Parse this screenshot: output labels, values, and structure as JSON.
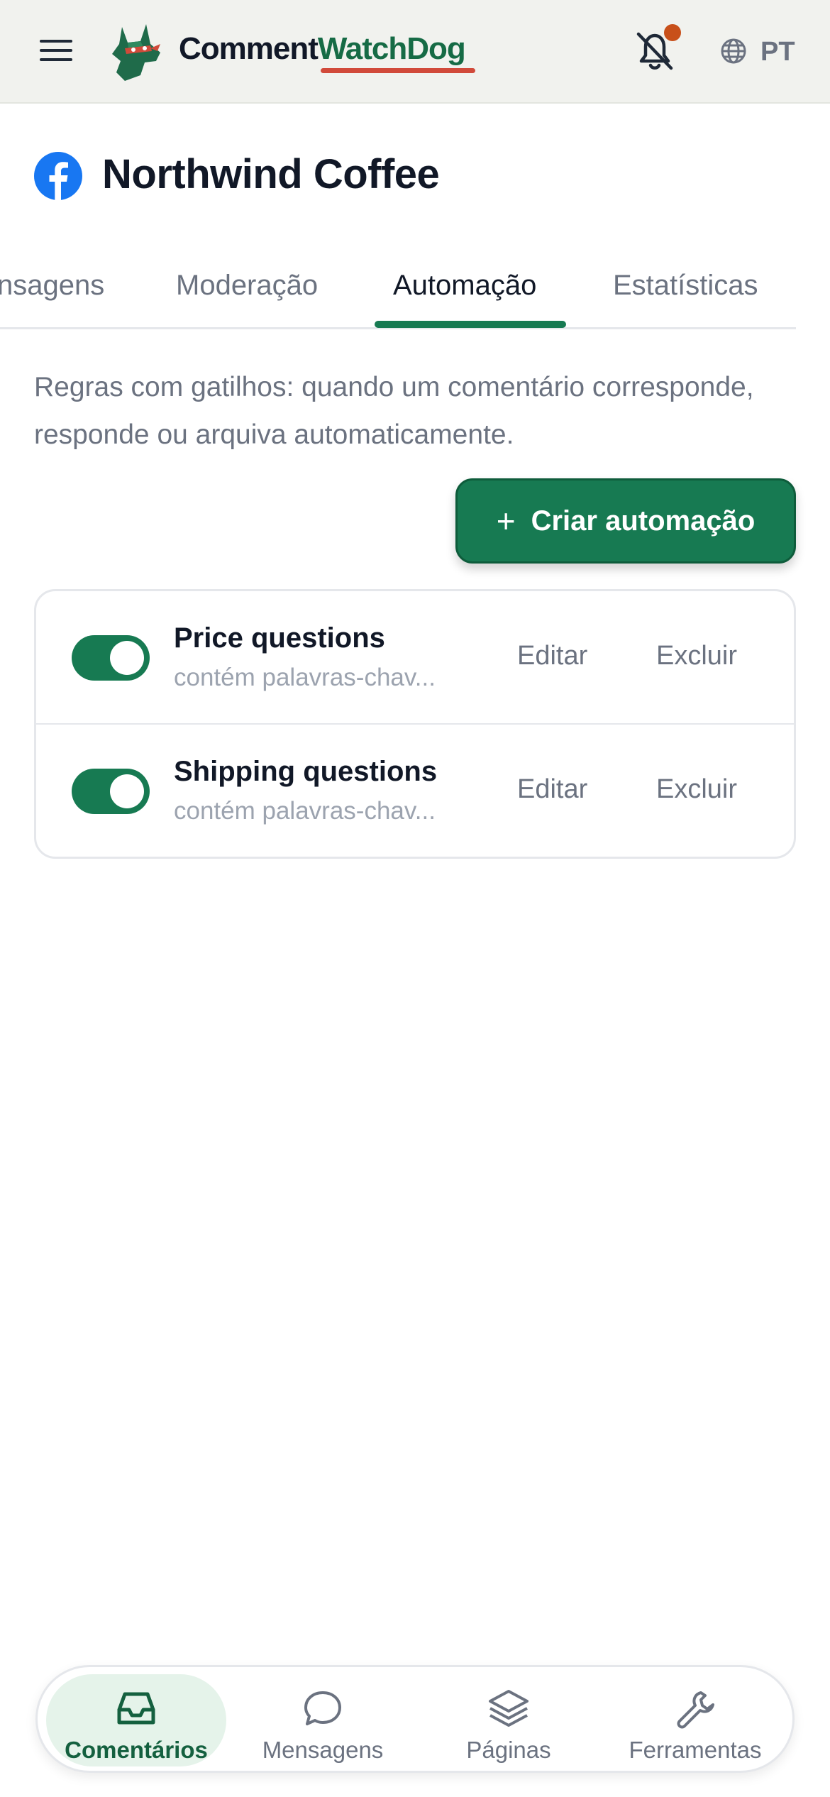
{
  "header": {
    "brand_part1": "Comment",
    "brand_part2": "WatchDog",
    "language": "PT",
    "accent_color": "#177a52",
    "notification_dot_color": "#c8501a"
  },
  "page": {
    "title": "Northwind Coffee",
    "platform_icon": "facebook-icon"
  },
  "tabs": [
    {
      "label": "nsagens"
    },
    {
      "label": "Moderação"
    },
    {
      "label": "Automação",
      "active": true
    },
    {
      "label": "Estatísticas"
    }
  ],
  "description": "Regras com gatilhos: quando um comentário corresponde, responde ou arquiva automaticamente.",
  "create_button": {
    "icon": "+",
    "label": "Criar automação"
  },
  "rules": [
    {
      "name": "Price questions",
      "subtitle": "contém palavras-chav...",
      "enabled": true,
      "edit_label": "Editar",
      "delete_label": "Excluir"
    },
    {
      "name": "Shipping questions",
      "subtitle": "contém palavras-chav...",
      "enabled": true,
      "edit_label": "Editar",
      "delete_label": "Excluir"
    }
  ],
  "bottom_nav": [
    {
      "label": "Comentários",
      "icon": "inbox-icon",
      "active": true
    },
    {
      "label": "Mensagens",
      "icon": "chat-bubble-icon"
    },
    {
      "label": "Páginas",
      "icon": "layers-icon"
    },
    {
      "label": "Ferramentas",
      "icon": "wrench-icon"
    }
  ]
}
